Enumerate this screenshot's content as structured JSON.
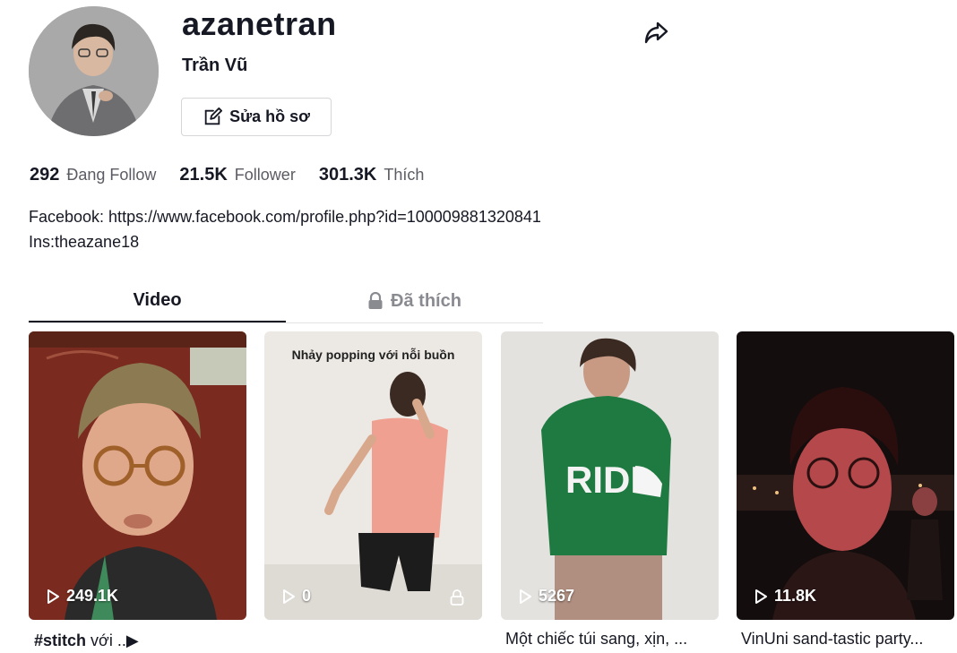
{
  "profile": {
    "username": "azanetran",
    "nickname": "Trần Vũ",
    "edit_label": "Sửa hồ sơ"
  },
  "stats": [
    {
      "value": "292",
      "label": "Đang Follow"
    },
    {
      "value": "21.5K",
      "label": "Follower"
    },
    {
      "value": "301.3K",
      "label": "Thích"
    }
  ],
  "bio": {
    "line1": "Facebook: https://www.facebook.com/profile.php?id=100009881320841",
    "line2": "Ins:theazane18"
  },
  "tabs": {
    "videos": "Video",
    "liked": "Đã thích"
  },
  "videos": [
    {
      "views": "249.1K",
      "caption_tag": "#stitch",
      "caption_text": " với ..▶",
      "overlay": ""
    },
    {
      "views": "0",
      "caption_tag": "",
      "caption_text": "",
      "overlay": "Nhảy popping với nỗi buồn",
      "locked": true
    },
    {
      "views": "5267",
      "caption_tag": "",
      "caption_text": "Một chiếc túi sang, xịn, ...",
      "overlay": ""
    },
    {
      "views": "11.8K",
      "caption_tag": "",
      "caption_text": "VinUni sand-tastic party...",
      "overlay": ""
    }
  ],
  "icons": {
    "share": "share-icon",
    "edit": "edit-icon",
    "lock": "lock-icon",
    "play": "play-icon"
  }
}
